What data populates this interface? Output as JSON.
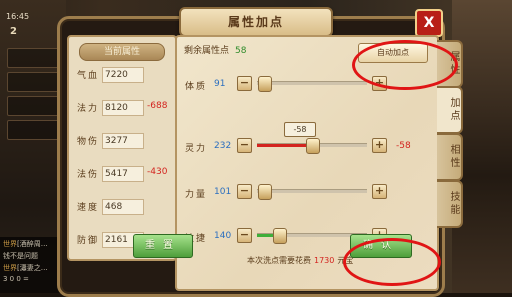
{
  "hud": {
    "time": "16:45",
    "level_num": "2"
  },
  "chat": [
    {
      "tag": "世界",
      "text": "[酒醉周…"
    },
    {
      "tag": "",
      "text": "钱不是问题"
    },
    {
      "tag": "世界",
      "text": "[瀟妻之…"
    },
    {
      "tag": "",
      "text": "3 0 0 ="
    }
  ],
  "dialog": {
    "title": "属性加点",
    "close": "X",
    "current_attr_title": "当前属性",
    "stats": [
      {
        "label": "气血",
        "value": "7220",
        "delta": ""
      },
      {
        "label": "法力",
        "value": "8120",
        "delta": "-688"
      },
      {
        "label": "物伤",
        "value": "3277",
        "delta": ""
      },
      {
        "label": "法伤",
        "value": "5417",
        "delta": "-430"
      },
      {
        "label": "速度",
        "value": "468",
        "delta": ""
      },
      {
        "label": "防御",
        "value": "2161",
        "delta": ""
      }
    ],
    "free_points_label": "剩余属性点",
    "free_points": "58",
    "auto_button": "自动加点",
    "attributes": [
      {
        "label": "体质",
        "value": "91",
        "level": 0.0,
        "delta": ""
      },
      {
        "label": "灵力",
        "value": "232",
        "level": 0.5,
        "delta": "-58"
      },
      {
        "label": "力量",
        "value": "101",
        "level": 0.0,
        "delta": ""
      },
      {
        "label": "敏捷",
        "value": "140",
        "level": 0.2,
        "delta": ""
      }
    ],
    "tooltip": "-58",
    "cost_prefix": "本次洗点需要花费",
    "cost_amount": "1730",
    "cost_suffix": "元宝",
    "reset_button": "重置",
    "confirm_button": "确认"
  },
  "tabs": [
    "属性",
    "加点",
    "相性",
    "技能"
  ],
  "colors": {
    "highlight_ring": "#e01515",
    "fill_red": "#d3241f",
    "fill_green": "#3fae3a"
  }
}
